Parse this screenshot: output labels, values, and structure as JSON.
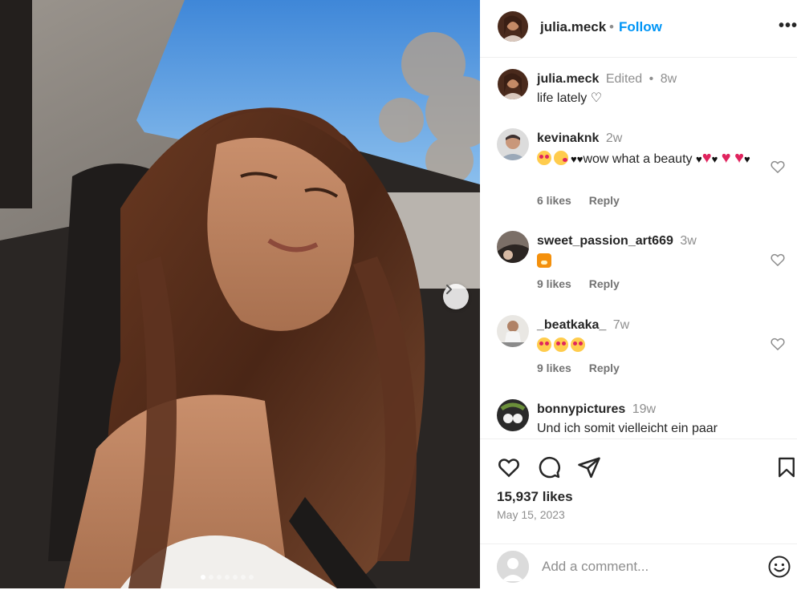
{
  "post": {
    "author": "julia.meck",
    "follow_label": "Follow",
    "header_separator": "•",
    "more_label": "•••",
    "image_count": 7,
    "active_image": 1
  },
  "caption": {
    "username": "julia.meck",
    "edited_label": "Edited",
    "separator": "•",
    "time": "8w",
    "text": "life lately ♡"
  },
  "comments": [
    {
      "username": "kevinaknk",
      "time": "2w",
      "text_main": "wow what a beauty",
      "likes": "6 likes",
      "reply": "Reply"
    },
    {
      "username": "sweet_passion_art669",
      "time": "3w",
      "text_main": "",
      "likes": "9 likes",
      "reply": "Reply"
    },
    {
      "username": "_beatkaka_",
      "time": "7w",
      "text_main": "",
      "likes": "9 likes",
      "reply": "Reply"
    },
    {
      "username": "bonnypictures",
      "time": "19w",
      "text_main": "Und ich somit vielleicht ein paar"
    }
  ],
  "stats": {
    "likes": "15,937 likes",
    "date": "May 15, 2023"
  },
  "add_comment": {
    "placeholder": "Add a comment..."
  },
  "colors": {
    "accent": "#0095f6",
    "secondary_text": "#8e8e8e",
    "primary_text": "#262626"
  },
  "icons": [
    "like-icon",
    "comment-icon",
    "share-icon",
    "save-icon",
    "emoji-icon",
    "chevron-right-icon",
    "more-icon"
  ]
}
